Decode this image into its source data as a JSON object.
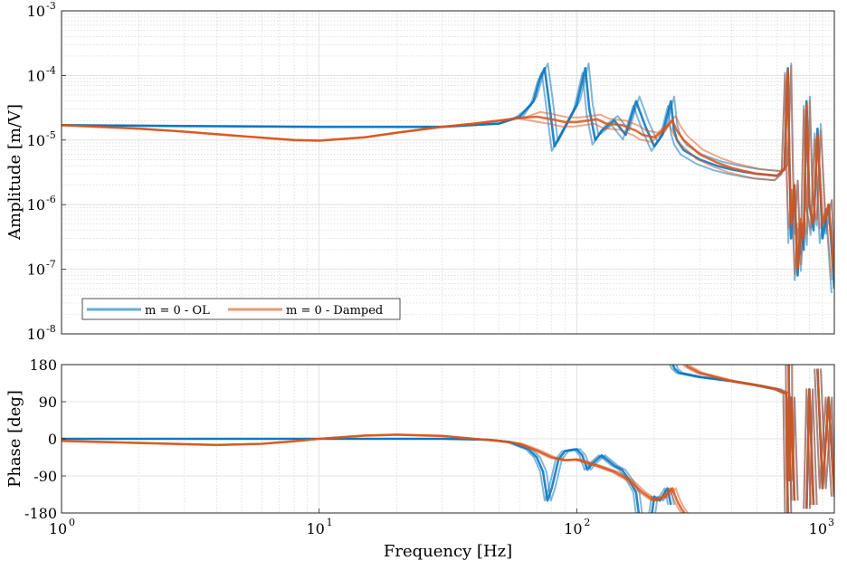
{
  "chart_data": [
    {
      "type": "line",
      "panel": "amplitude",
      "xscale": "log",
      "yscale": "log",
      "xlim": [
        1,
        1000
      ],
      "ylim": [
        1e-08,
        0.001
      ],
      "ylabel": "Amplitude [m/V]",
      "grid": true,
      "legend": {
        "placement": "bottom-left",
        "entries": [
          "m = 0 - OL",
          "m = 0 - Damped"
        ]
      },
      "yticks": [
        {
          "mantissa": "10",
          "exp": "-8"
        },
        {
          "mantissa": "10",
          "exp": "-7"
        },
        {
          "mantissa": "10",
          "exp": "-6"
        },
        {
          "mantissa": "10",
          "exp": "-5"
        },
        {
          "mantissa": "10",
          "exp": "-4"
        },
        {
          "mantissa": "10",
          "exp": "-3"
        }
      ],
      "series": [
        {
          "name": "m = 0 - OL",
          "color": "#0072BD",
          "x": [
            1,
            3,
            10,
            30,
            50,
            60,
            68,
            72,
            75,
            78,
            82,
            90,
            100,
            108,
            112,
            118,
            125,
            140,
            155,
            170,
            185,
            200,
            215,
            225,
            232,
            238,
            245,
            260,
            300,
            350,
            400,
            450,
            500,
            550,
            600,
            640,
            660,
            670,
            680,
            700,
            720,
            740,
            760,
            780,
            800,
            830,
            860,
            900,
            950,
            1000
          ],
          "y": [
            1.7e-05,
            1.65e-05,
            1.6e-05,
            1.6e-05,
            1.8e-05,
            2.3e-05,
            4e-05,
            9e-05,
            0.00013,
            4e-05,
            8e-06,
            1.6e-05,
            3.5e-05,
            0.00013,
            3e-05,
            1e-05,
            1.4e-05,
            2e-05,
            1.2e-05,
            4e-05,
            1.6e-05,
            8e-06,
            1.2e-05,
            2.5e-05,
            4e-05,
            1.5e-05,
            1e-05,
            7e-06,
            5e-06,
            4e-06,
            3.5e-06,
            3.2e-06,
            3e-06,
            2.9e-06,
            2.8e-06,
            3.5e-06,
            0.00013,
            4e-06,
            3e-07,
            2e-06,
            8e-08,
            5e-07,
            2e-07,
            4e-05,
            1e-06,
            4e-07,
            1.5e-05,
            3e-07,
            1e-06,
            5e-08
          ]
        },
        {
          "name": "m = 0 - Damped",
          "color": "#D95319",
          "x": [
            1,
            2,
            3,
            5,
            8,
            10,
            15,
            20,
            30,
            40,
            50,
            60,
            70,
            80,
            90,
            100,
            110,
            120,
            130,
            150,
            170,
            180,
            200,
            220,
            235,
            245,
            260,
            300,
            350,
            400,
            450,
            500,
            550,
            600,
            640,
            660,
            670,
            680,
            700,
            720,
            740,
            760,
            780,
            800,
            830,
            860,
            900,
            950,
            1000
          ],
          "y": [
            1.7e-05,
            1.5e-05,
            1.35e-05,
            1.15e-05,
            1e-05,
            9.8e-06,
            1.1e-05,
            1.3e-05,
            1.6e-05,
            1.8e-05,
            2e-05,
            2.2e-05,
            2.3e-05,
            2.1e-05,
            1.9e-05,
            1.9e-05,
            2e-05,
            2.1e-05,
            1.8e-05,
            1.7e-05,
            1.4e-05,
            1.2e-05,
            1.1e-05,
            1.5e-05,
            2e-05,
            1.4e-05,
            1e-05,
            6e-06,
            4.5e-06,
            3.7e-06,
            3.3e-06,
            3e-06,
            2.9e-06,
            2.8e-06,
            3.5e-06,
            0.00012,
            3e-06,
            5e-07,
            2e-06,
            1e-07,
            6e-07,
            3e-07,
            3.5e-05,
            1e-06,
            5e-07,
            1.2e-05,
            5e-07,
            1e-06,
            8e-08
          ]
        }
      ]
    },
    {
      "type": "line",
      "panel": "phase",
      "xscale": "log",
      "xlim": [
        1,
        1000
      ],
      "ylim": [
        -180,
        180
      ],
      "ylabel": "Phase [deg]",
      "xlabel": "Frequency [Hz]",
      "grid": true,
      "yticks": [
        "-180",
        "-90",
        "0",
        "90",
        "180"
      ],
      "xticks": [
        {
          "mantissa": "10",
          "exp": "0"
        },
        {
          "mantissa": "10",
          "exp": "1"
        },
        {
          "mantissa": "10",
          "exp": "2"
        },
        {
          "mantissa": "10",
          "exp": "3"
        }
      ],
      "series": [
        {
          "name": "m = 0 - OL",
          "color": "#0072BD",
          "x": [
            1,
            5,
            10,
            30,
            45,
            55,
            65,
            70,
            74,
            77,
            80,
            85,
            90,
            100,
            105,
            110,
            115,
            125,
            140,
            150,
            160,
            170,
            174,
            178,
            181,
            185,
            189,
            192,
            196,
            200,
            210,
            225,
            232,
            236,
            240,
            250,
            300,
            400,
            500,
            600,
            650,
            660,
            665,
            670,
            680,
            700,
            720,
            740,
            760,
            780,
            800,
            830,
            860,
            900,
            950,
            1000
          ],
          "y": [
            0,
            0,
            0,
            0,
            -2,
            -8,
            -25,
            -45,
            -80,
            -150,
            -120,
            -50,
            -30,
            -25,
            -40,
            -75,
            -60,
            -40,
            -65,
            -75,
            -100,
            -130,
            -180,
            180,
            -180,
            180,
            -180,
            180,
            -180,
            -140,
            -150,
            -120,
            -160,
            180,
            170,
            160,
            150,
            140,
            130,
            120,
            110,
            -180,
            180,
            -100,
            100,
            -150,
            160,
            -180,
            150,
            -170,
            120,
            -160,
            170,
            -120,
            100,
            -140
          ]
        },
        {
          "name": "m = 0 - Damped",
          "color": "#D95319",
          "x": [
            1,
            2,
            4,
            6,
            8,
            10,
            15,
            20,
            30,
            40,
            50,
            60,
            70,
            80,
            90,
            100,
            110,
            120,
            140,
            160,
            180,
            200,
            220,
            235,
            245,
            255,
            262,
            266,
            270,
            300,
            400,
            500,
            600,
            650,
            660,
            665,
            670,
            680,
            700,
            720,
            740,
            760,
            780,
            800,
            830,
            860,
            900,
            950,
            1000
          ],
          "y": [
            -5,
            -10,
            -15,
            -12,
            -6,
            0,
            8,
            10,
            7,
            0,
            -5,
            -12,
            -28,
            -45,
            -52,
            -50,
            -58,
            -65,
            -80,
            -100,
            -130,
            -150,
            -140,
            -120,
            -150,
            -170,
            -180,
            180,
            175,
            160,
            140,
            130,
            120,
            110,
            -180,
            180,
            -100,
            100,
            -150,
            160,
            -180,
            150,
            -170,
            120,
            -160,
            170,
            -120,
            100,
            -140
          ]
        }
      ]
    }
  ]
}
